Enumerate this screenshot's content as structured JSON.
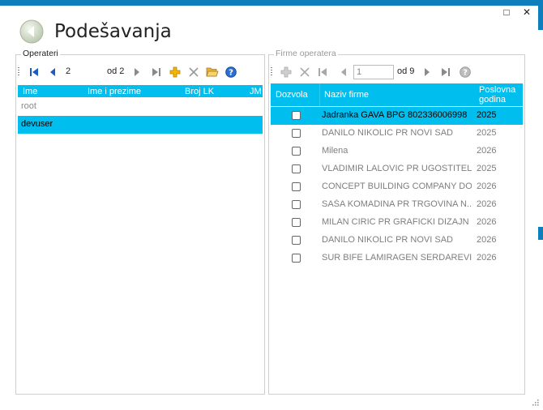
{
  "window": {
    "title": "Podešavanja",
    "maximize_symbol": "□",
    "close_symbol": "✕"
  },
  "operateri": {
    "label": "Operateri",
    "pager": {
      "current": "2",
      "total_label": "od 2"
    },
    "columns": [
      "Ime",
      "Ime i prezime",
      "Broj LK",
      "JM"
    ],
    "rows": [
      {
        "ime": "root",
        "selected": false
      },
      {
        "ime": "devuser",
        "selected": true
      }
    ]
  },
  "firme": {
    "label": "Firme operatera",
    "pager": {
      "current": "1",
      "total_label": "od 9"
    },
    "columns": {
      "dozvola": "Dozvola",
      "naziv": "Naziv firme",
      "godina_line1": "Poslovna",
      "godina_line2": "godina"
    },
    "rows": [
      {
        "naziv": "Jadranka GAVA BPG 802336006998",
        "godina": "2025",
        "selected": true
      },
      {
        "naziv": "DANILO NIKOLIC PR NOVI SAD",
        "godina": "2025",
        "selected": false
      },
      {
        "naziv": "Milena",
        "godina": "2026",
        "selected": false
      },
      {
        "naziv": "VLADIMIR LALOVIC PR UGOSTITELJ...",
        "godina": "2025",
        "selected": false
      },
      {
        "naziv": "CONCEPT BUILDING COMPANY DO...",
        "godina": "2026",
        "selected": false
      },
      {
        "naziv": "SAŠA KOMADINA PR TRGOVINA N...",
        "godina": "2026",
        "selected": false
      },
      {
        "naziv": "MILAN CIRIC PR GRAFICKI DIZAJN ...",
        "godina": "2026",
        "selected": false
      },
      {
        "naziv": "DANILO NIKOLIC PR NOVI SAD",
        "godina": "2026",
        "selected": false
      },
      {
        "naziv": "SUR BIFE LAMIRAGEN SERDAREVI...",
        "godina": "2026",
        "selected": false
      }
    ]
  },
  "colors": {
    "accent": "#00bfef",
    "brand": "#0e7fbd",
    "nav_blue": "#1a5cc4"
  }
}
